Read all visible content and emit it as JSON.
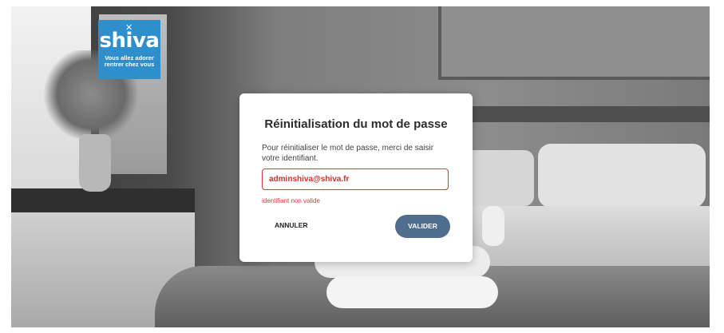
{
  "brand": {
    "logo_word": "shiva",
    "tagline_line1": "Vous allez adorer",
    "tagline_line2": "rentrer chez vous",
    "color": "#2f8fcc"
  },
  "dialog": {
    "title": "Réinitialisation du mot de passe",
    "instructions": "Pour réinitialiser le mot de passe, merci de saisir votre identifiant.",
    "identifier_value": "adminshiva@shiva.fr",
    "error_message": "identifiant non valide",
    "cancel_label": "ANNULER",
    "validate_label": "VALIDER",
    "error_color": "#d9383a",
    "primary_color": "#4f6e8d"
  }
}
